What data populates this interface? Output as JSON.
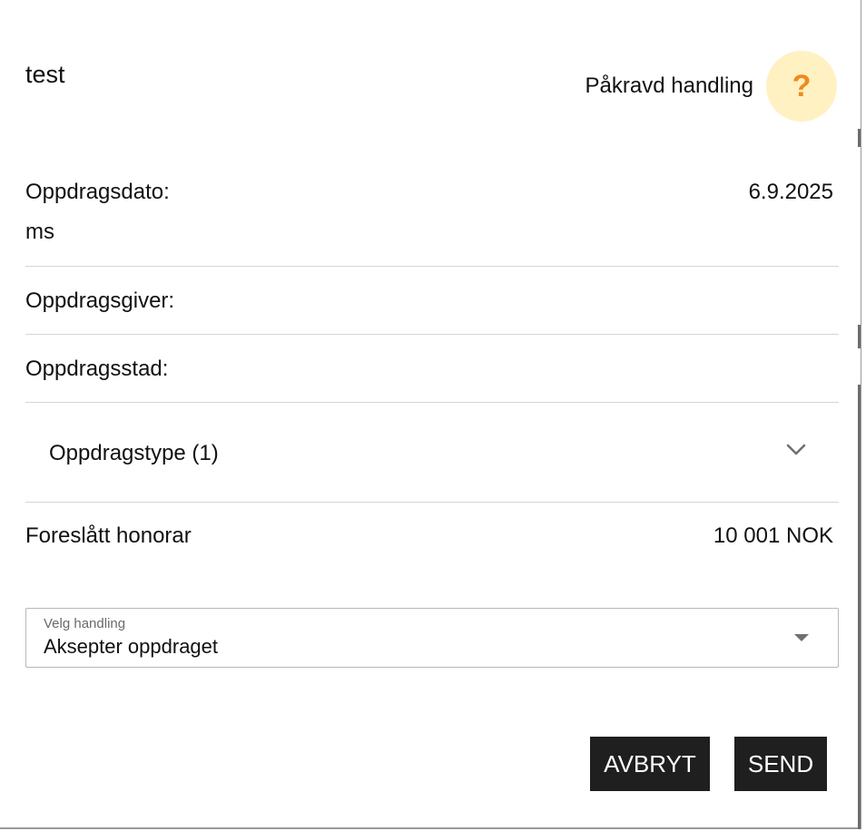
{
  "header": {
    "title": "test",
    "status_label": "Påkravd handling",
    "status_icon_symbol": "?",
    "status_icon_name": "question-icon",
    "status_color": "#f08a1c",
    "status_background": "#fff1c2"
  },
  "details": {
    "date_label": "Oppdragsdato:",
    "date_value": "6.9.2025",
    "date_sub": "ms",
    "client_label": "Oppdragsgiver:",
    "location_label": "Oppdragsstad:"
  },
  "assignment_type": {
    "label": "Oppdragstype (1)",
    "icon": "chevron-down-icon"
  },
  "fee": {
    "label": "Foreslått honorar",
    "value": "10 001 NOK"
  },
  "action_select": {
    "caption": "Velg handling",
    "selected": "Aksepter oppdraget"
  },
  "buttons": {
    "cancel_label": "AVBRYT",
    "send_label": "SEND",
    "background": "#1f1f1f"
  }
}
